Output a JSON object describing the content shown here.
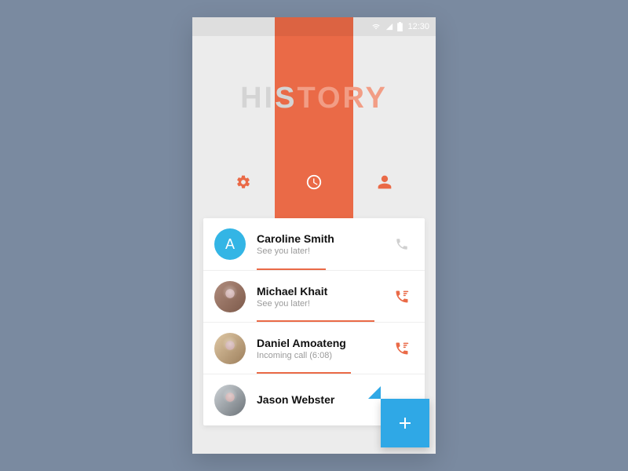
{
  "status": {
    "time": "12:30"
  },
  "header": {
    "title_plain_prefix": "HIS",
    "title_accent": "TORY",
    "tabs": {
      "settings": "settings",
      "history": "history",
      "contacts": "contacts"
    }
  },
  "calls": [
    {
      "name": "Caroline Smith",
      "subtitle": "See you later!",
      "avatar_type": "letter",
      "avatar_letter": "A",
      "avatar_color": "#33b5e5",
      "call_type": "outgoing",
      "call_icon_color": "#d0d0d0",
      "underline_width": 88
    },
    {
      "name": "Michael Khait",
      "subtitle": "See you later!",
      "avatar_type": "photo",
      "call_type": "missed",
      "call_icon_color": "#ea6a47",
      "underline_width": 150
    },
    {
      "name": "Daniel Amoateng",
      "subtitle": "Incoming call (6:08)",
      "avatar_type": "photo",
      "call_type": "missed",
      "call_icon_color": "#ea6a47",
      "underline_width": 120
    },
    {
      "name": "Jason Webster",
      "subtitle": "",
      "avatar_type": "photo",
      "call_type": "none",
      "underline_width": 0
    }
  ],
  "fab": {
    "label": "+"
  },
  "colors": {
    "accent": "#ea6a47",
    "fab": "#2fa8e6",
    "bg": "#ececec"
  }
}
